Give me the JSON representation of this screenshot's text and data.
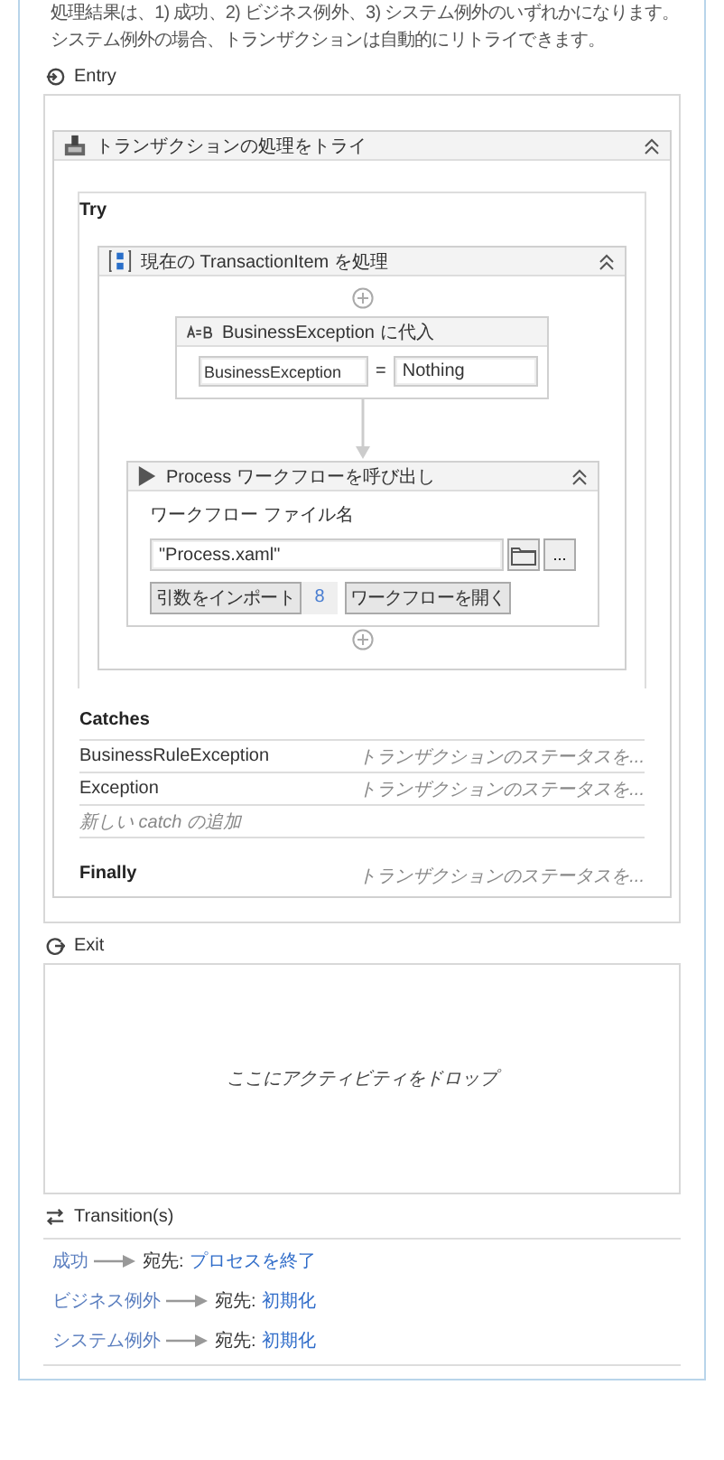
{
  "description": [
    "処理結果は、1) 成功、2) ビジネス例外、3) システム例外のいずれかになります。",
    "システム例外の場合、トランザクションは自動的にリトライできます。"
  ],
  "entry": {
    "label": "Entry",
    "try_catch": {
      "title": "トランザクションの処理をトライ",
      "try_label": "Try",
      "sequence": {
        "title": "現在の TransactionItem を処理",
        "assign": {
          "title": "BusinessException に代入",
          "to": "BusinessException",
          "operator": "=",
          "value": "Nothing"
        },
        "invoke": {
          "title": "Process ワークフローを呼び出し",
          "file_label": "ワークフロー ファイル名",
          "file_value": "\"Process.xaml\"",
          "browse_button": "...",
          "import_button": "引数をインポート",
          "argument_count": "8",
          "open_button": "ワークフローを開く"
        }
      },
      "catches_label": "Catches",
      "catches": [
        {
          "exception": "BusinessRuleException",
          "action": "トランザクションのステータスを..."
        },
        {
          "exception": "Exception",
          "action": "トランザクションのステータスを..."
        }
      ],
      "add_catch": "新しい catch の追加",
      "finally_label": "Finally",
      "finally_action": "トランザクションのステータスを..."
    }
  },
  "exit": {
    "label": "Exit",
    "placeholder": "ここにアクティビティをドロップ"
  },
  "transitions": {
    "label": "Transition(s)",
    "items": [
      {
        "trigger": "成功",
        "prefix": "宛先:",
        "target": "プロセスを終了"
      },
      {
        "trigger": "ビジネス例外",
        "prefix": "宛先:",
        "target": "初期化"
      },
      {
        "trigger": "システム例外",
        "prefix": "宛先:",
        "target": "初期化"
      }
    ]
  }
}
